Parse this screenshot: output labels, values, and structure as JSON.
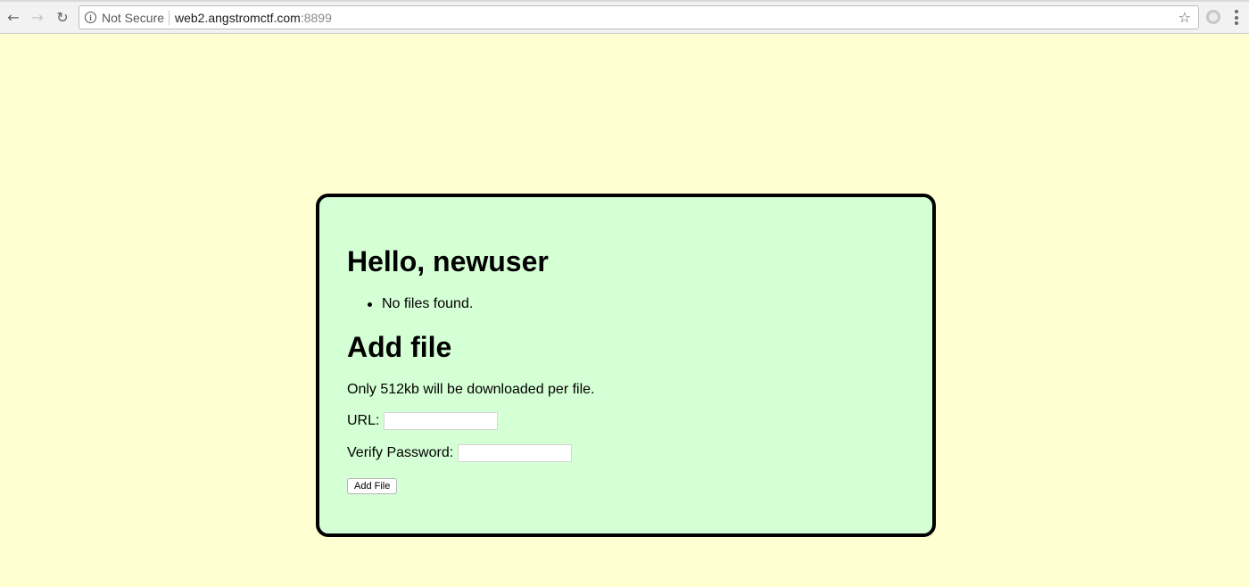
{
  "browser": {
    "security_label": "Not Secure",
    "url_host": "web2.angstromctf.com",
    "url_port": ":8899",
    "icons": {
      "back": "back-arrow-icon",
      "forward": "forward-arrow-icon",
      "reload": "reload-icon",
      "info": "info-icon",
      "bookmark": "star-icon",
      "extension": "extension-icon",
      "menu": "kebab-menu-icon"
    }
  },
  "page": {
    "background_color": "#ffffd2",
    "card_color": "#d5ffd5",
    "greeting": "Hello, newuser",
    "files": [
      "No files found."
    ],
    "add_title": "Add file",
    "note": "Only 512kb will be downloaded per file.",
    "url_label": "URL:",
    "url_value": "",
    "password_label": "Verify Password:",
    "password_value": "",
    "submit_label": "Add File"
  }
}
